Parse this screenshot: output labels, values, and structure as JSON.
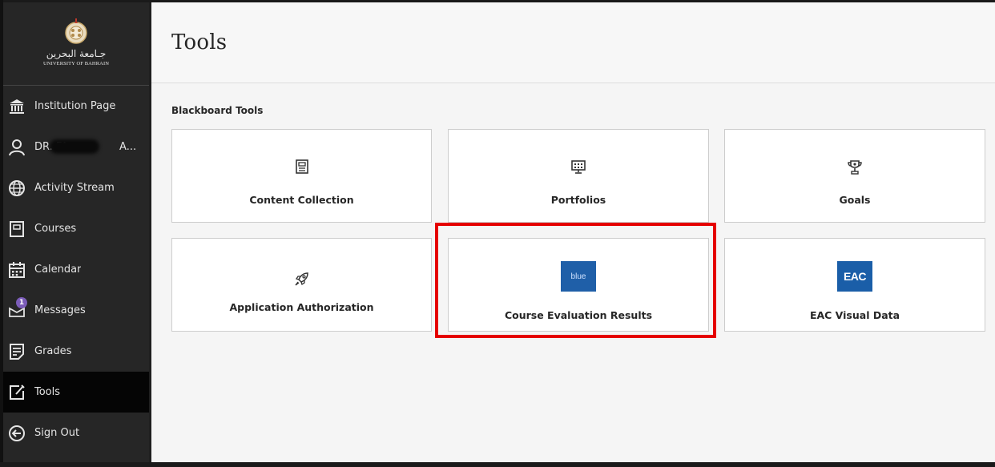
{
  "sidebar": {
    "logo": {
      "arabic_text": "جـامعة البحرين",
      "english_text": "UNIVERSITY OF BAHRAIN",
      "crest_icon": "university-crest"
    },
    "items": [
      {
        "label": "Institution Page",
        "icon": "institution-icon"
      },
      {
        "label": "DR. FA",
        "label_tail": "A...",
        "icon": "person-icon",
        "redacted": true
      },
      {
        "label": "Activity Stream",
        "icon": "globe-icon"
      },
      {
        "label": "Courses",
        "icon": "courses-icon"
      },
      {
        "label": "Calendar",
        "icon": "calendar-icon"
      },
      {
        "label": "Messages",
        "icon": "messages-icon",
        "badge": "1"
      },
      {
        "label": "Grades",
        "icon": "grades-icon"
      },
      {
        "label": "Tools",
        "icon": "tools-icon",
        "active": true
      },
      {
        "label": "Sign Out",
        "icon": "sign-out-icon"
      }
    ]
  },
  "main": {
    "title": "Tools",
    "section_title": "Blackboard Tools",
    "tiles": [
      {
        "label": "Content Collection",
        "icon": "content-collection-icon"
      },
      {
        "label": "Portfolios",
        "icon": "portfolios-icon"
      },
      {
        "label": "Goals",
        "icon": "trophy-icon"
      },
      {
        "label": "Application Authorization",
        "icon": "rocket-icon"
      },
      {
        "label": "Course Evaluation Results",
        "icon": "blue-logo",
        "logo_text": "blue",
        "highlighted": true
      },
      {
        "label": "EAC Visual Data",
        "icon": "eac-logo",
        "logo_text": "EAC"
      }
    ]
  },
  "colors": {
    "sidebar_bg": "#262626",
    "active_bg": "#050505",
    "highlight": "#e50000",
    "badge": "#7b5cb8",
    "blue_logo": "#1f5fa8"
  }
}
